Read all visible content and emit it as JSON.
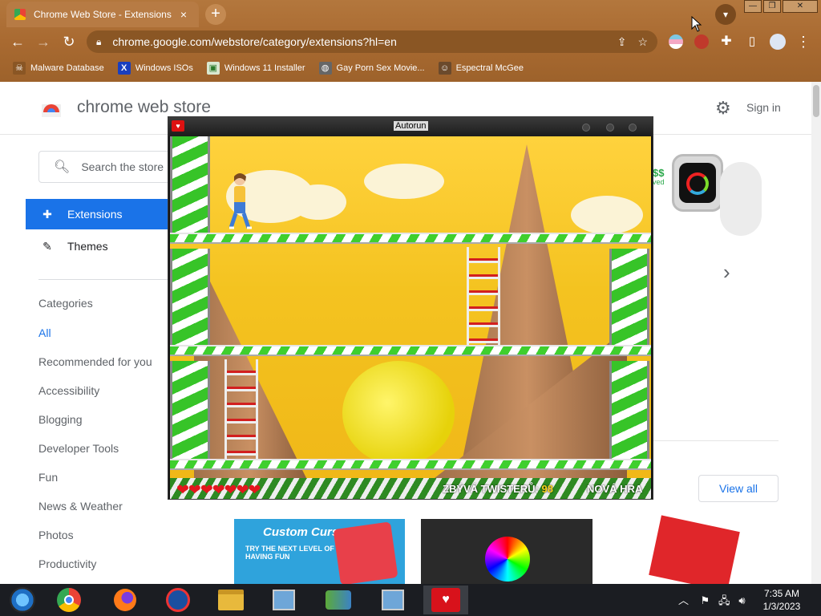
{
  "browser": {
    "tab_title": "Chrome Web Store - Extensions",
    "tab_close": "×",
    "new_tab": "+",
    "url": "chrome.google.com/webstore/category/extensions?hl=en",
    "window_controls": [
      "—",
      "❐",
      "✕"
    ]
  },
  "bookmarks": [
    {
      "label": "Malware Database",
      "icon": "skull-icon"
    },
    {
      "label": "Windows ISOs",
      "icon": "x-logo-icon"
    },
    {
      "label": "Windows 11 Installer",
      "icon": "image-icon"
    },
    {
      "label": "Gay Porn Sex Movie...",
      "icon": "globe-icon"
    },
    {
      "label": "Espectral McGee",
      "icon": "avatar-icon"
    }
  ],
  "store": {
    "title": "chrome web store",
    "sign_in": "Sign in",
    "search_placeholder": "Search the store",
    "nav": {
      "extensions": "Extensions",
      "themes": "Themes"
    },
    "categories_title": "Categories",
    "categories": [
      "All",
      "Recommended for you",
      "Accessibility",
      "Blogging",
      "Developer Tools",
      "Fun",
      "News & Weather",
      "Photos",
      "Productivity"
    ],
    "view_all": "View all",
    "promo_price": "$$",
    "promo_saved": "ved"
  },
  "autorun": {
    "title": "Autorun",
    "hearts": "❤❤❤❤❤❤❤",
    "remaining_label": "ZBÝVÁ TWISTERŮ:",
    "remaining_count": "98",
    "new_game": "NOVÁ HRA"
  },
  "tiles": {
    "custom_cursor": "Custom Cursor",
    "cursor_tagline": "TRY THE NEXT LEVEL OF HAVING FUN"
  },
  "taskbar": {
    "time": "7:35 AM",
    "date": "1/3/2023"
  }
}
